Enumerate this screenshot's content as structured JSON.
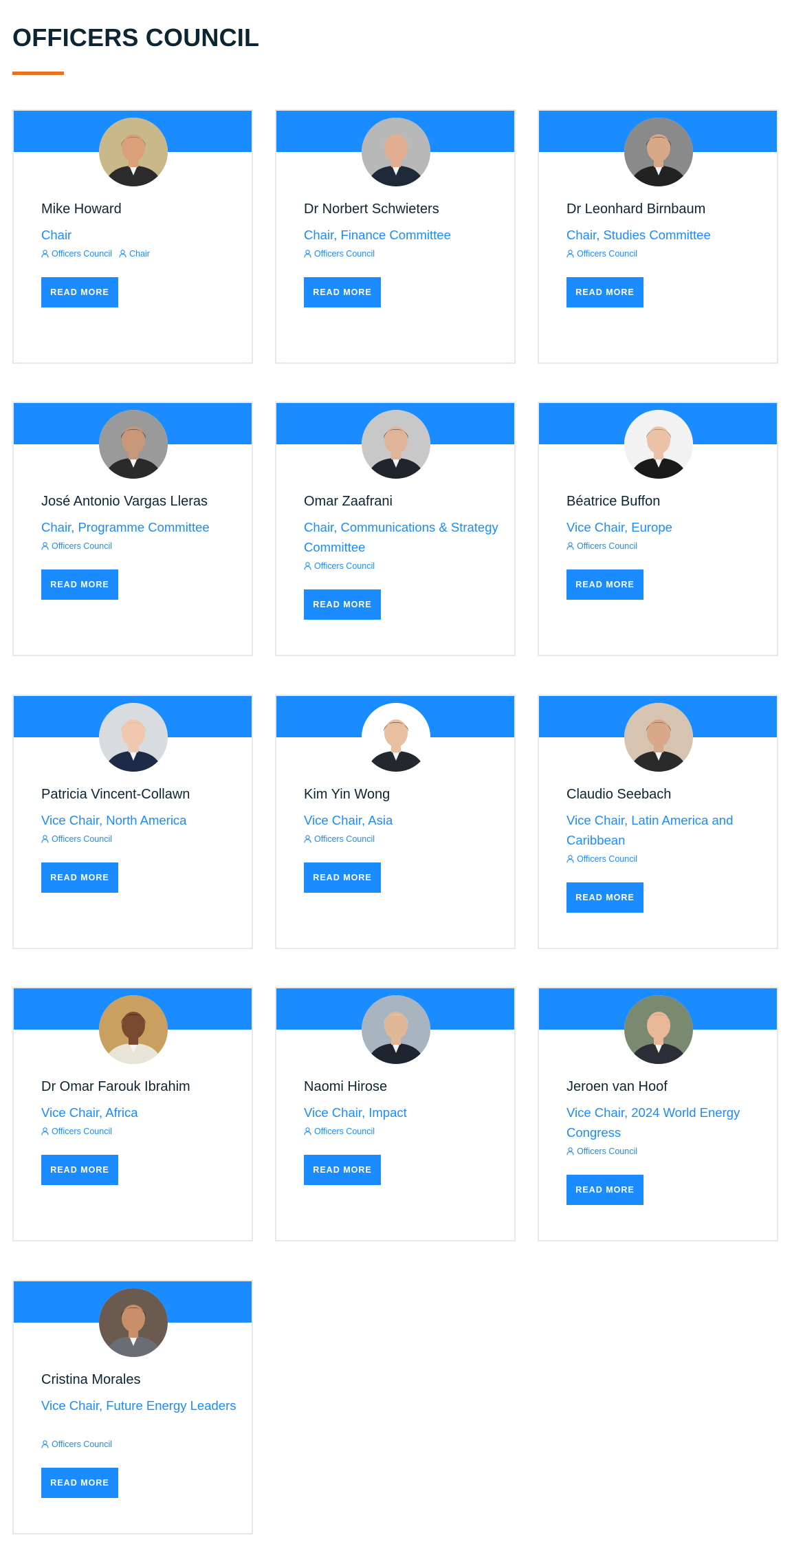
{
  "page_title": "OFFICERS COUNCIL",
  "colors": {
    "accent": "#1a8cff",
    "heading": "#0d2433",
    "rule": "#e8731e"
  },
  "tag_icon": "person-outline-icon",
  "members": [
    {
      "name": "Mike Howard",
      "role": "Chair",
      "tags": [
        "Officers Council",
        "Chair"
      ],
      "button": "READ MORE"
    },
    {
      "name": "Dr Norbert Schwieters",
      "role": "Chair, Finance Committee",
      "tags": [
        "Officers Council"
      ],
      "button": "READ MORE"
    },
    {
      "name": "Dr Leonhard Birnbaum",
      "role": "Chair, Studies Committee",
      "tags": [
        "Officers Council"
      ],
      "button": "READ MORE"
    },
    {
      "name": "José Antonio Vargas Lleras",
      "role": "Chair, Programme Committee",
      "tags": [
        "Officers Council"
      ],
      "button": "READ MORE"
    },
    {
      "name": "Omar Zaafrani",
      "role": "Chair, Communications & Strategy Committee",
      "tags": [
        "Officers Council"
      ],
      "button": "READ MORE"
    },
    {
      "name": "Béatrice Buffon",
      "role": "Vice Chair, Europe",
      "tags": [
        "Officers Council"
      ],
      "button": "READ MORE"
    },
    {
      "name": "Patricia Vincent-Collawn",
      "role": "Vice Chair, North America",
      "tags": [
        "Officers Council"
      ],
      "button": "READ MORE"
    },
    {
      "name": "Kim Yin Wong",
      "role": "Vice Chair, Asia",
      "tags": [
        "Officers Council"
      ],
      "button": "READ MORE"
    },
    {
      "name": "Claudio Seebach",
      "role": "Vice Chair, Latin America and Caribbean",
      "tags": [
        "Officers Council"
      ],
      "button": "READ MORE"
    },
    {
      "name": "Dr Omar Farouk Ibrahim",
      "role": "Vice Chair, Africa",
      "tags": [
        "Officers Council"
      ],
      "button": "READ MORE"
    },
    {
      "name": "Naomi Hirose",
      "role": "Vice Chair, Impact",
      "tags": [
        "Officers Council"
      ],
      "button": "READ MORE"
    },
    {
      "name": "Jeroen van Hoof",
      "role": "Vice Chair, 2024 World Energy Congress",
      "tags": [
        "Officers Council"
      ],
      "button": "READ MORE"
    },
    {
      "name": "Cristina Morales",
      "role": "Vice Chair, Future Energy Leaders",
      "tags": [
        "Officers Council"
      ],
      "button": "READ MORE"
    }
  ]
}
